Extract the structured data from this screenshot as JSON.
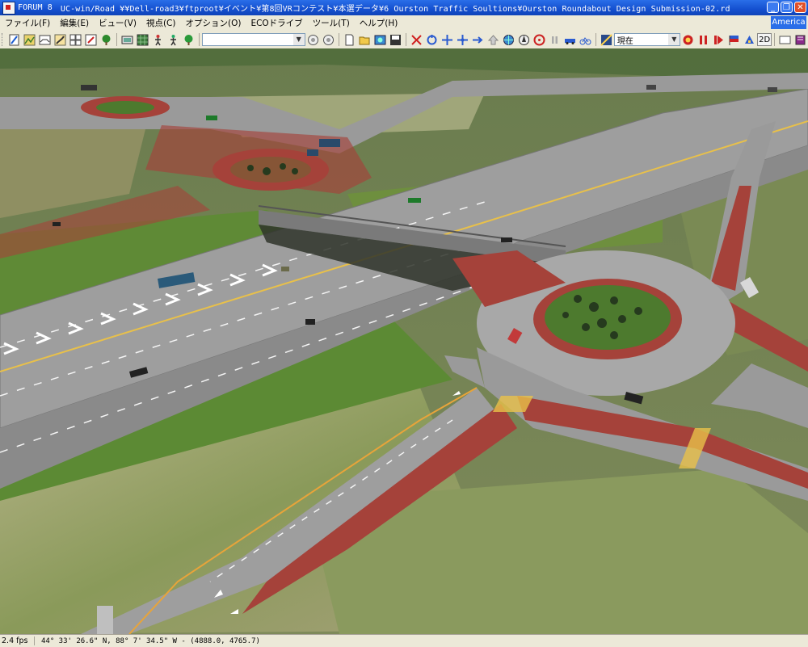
{
  "window": {
    "app_name": "FORUM 8",
    "title": "UC-win/Road    ¥¥Dell-road3¥ftproot¥イベント¥第8回VRコンテスト¥本選データ¥6 Ourston Traffic Soultions¥Ourston Roundabout Design Submission-02.rd"
  },
  "menu": {
    "items": [
      "ファイル(F)",
      "編集(E)",
      "ビュー(V)",
      "視点(C)",
      "オプション(O)",
      "ECOドライブ",
      "ツール(T)",
      "ヘルプ(H)"
    ],
    "region": "America"
  },
  "toolbar": {
    "view_combo_value": "",
    "time_combo_value": "現在",
    "mode_2d_label": "2D"
  },
  "status": {
    "fps": "2.4 fps",
    "coordinates": "44° 33' 26.6\" N, 88° 7' 34.5\" W  -  (4888.0, 4765.7)"
  },
  "colors": {
    "titlebar": "#1450d0",
    "asphalt": "#9e9e9e",
    "bike_lane": "#a5423a",
    "grass": "#4d7a2e",
    "terrain": "#8a8a5a"
  }
}
